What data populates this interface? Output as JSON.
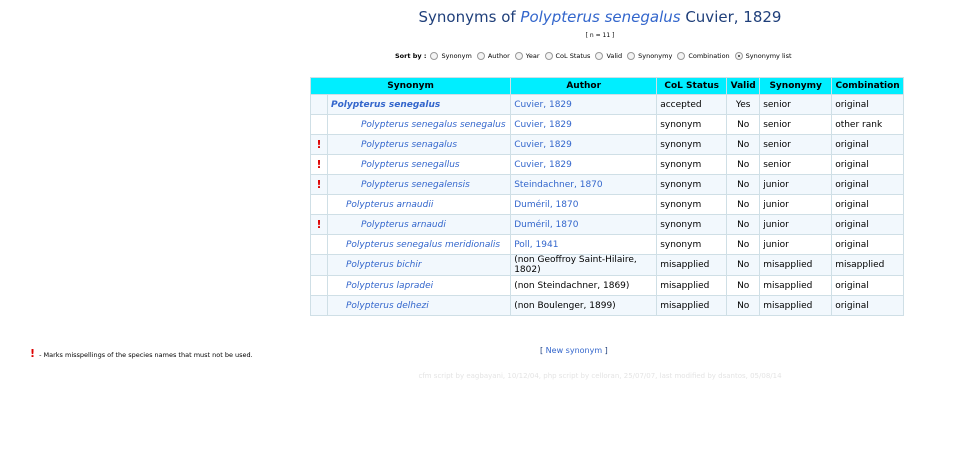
{
  "title": {
    "prefix": "Synonyms of ",
    "species": "Polypterus senegalus",
    "suffix": " Cuvier, 1829"
  },
  "count": "[ n = 11 ]",
  "sort": {
    "label": "Sort by :",
    "options": [
      {
        "label": "Synonym",
        "selected": false
      },
      {
        "label": "Author",
        "selected": false
      },
      {
        "label": "Year",
        "selected": false
      },
      {
        "label": "CoL Status",
        "selected": false
      },
      {
        "label": "Valid",
        "selected": false
      },
      {
        "label": "Synonymy",
        "selected": false
      },
      {
        "label": "Combination",
        "selected": false
      },
      {
        "label": "Synonymy list",
        "selected": true
      }
    ]
  },
  "table": {
    "headers": {
      "synonym": "Synonym",
      "author": "Author",
      "status": "CoL Status",
      "valid": "Valid",
      "synonymy": "Synonymy",
      "combination": "Combination"
    },
    "rows": [
      {
        "mark": "",
        "synonym": "Polypterus senegalus",
        "author": "Cuvier, 1829",
        "status": "accepted",
        "valid": "Yes",
        "synonymy": "senior",
        "combination": "original"
      },
      {
        "mark": "",
        "synonym": "Polypterus senegalus senegalus",
        "author": "Cuvier, 1829",
        "status": "synonym",
        "valid": "No",
        "synonymy": "senior",
        "combination": "other rank"
      },
      {
        "mark": "!",
        "synonym": "Polypterus senagalus",
        "author": "Cuvier, 1829",
        "status": "synonym",
        "valid": "No",
        "synonymy": "senior",
        "combination": "original"
      },
      {
        "mark": "!",
        "synonym": "Polypterus senegallus",
        "author": "Cuvier, 1829",
        "status": "synonym",
        "valid": "No",
        "synonymy": "senior",
        "combination": "original"
      },
      {
        "mark": "!",
        "synonym": "Polypterus senegalensis",
        "author": "Steindachner, 1870",
        "status": "synonym",
        "valid": "No",
        "synonymy": "junior",
        "combination": "original"
      },
      {
        "mark": "",
        "synonym": "Polypterus arnaudii",
        "author": "Duméril, 1870",
        "status": "synonym",
        "valid": "No",
        "synonymy": "junior",
        "combination": "original"
      },
      {
        "mark": "!",
        "synonym": "Polypterus arnaudi",
        "author": "Duméril, 1870",
        "status": "synonym",
        "valid": "No",
        "synonymy": "junior",
        "combination": "original"
      },
      {
        "mark": "",
        "synonym": "Polypterus senegalus meridionalis",
        "author": "Poll, 1941",
        "status": "synonym",
        "valid": "No",
        "synonymy": "junior",
        "combination": "original"
      },
      {
        "mark": "",
        "synonym": "Polypterus bichir",
        "author": "(non Geoffroy Saint-Hilaire, 1802)",
        "status": "misapplied",
        "valid": "No",
        "synonymy": "misapplied",
        "combination": "misapplied"
      },
      {
        "mark": "",
        "synonym": "Polypterus lapradei",
        "author": "(non Steindachner, 1869)",
        "status": "misapplied",
        "valid": "No",
        "synonymy": "misapplied",
        "combination": "original"
      },
      {
        "mark": "",
        "synonym": "Polypterus delhezi",
        "author": "(non Boulenger, 1899)",
        "status": "misapplied",
        "valid": "No",
        "synonymy": "misapplied",
        "combination": "original"
      }
    ]
  },
  "legend": {
    "mark": "!",
    "text": " - Marks misspellings of the species names that must not be used."
  },
  "new_synonym": {
    "open": "[ ",
    "link": "New synonym",
    "close": " ]"
  },
  "footer": "cfm script by eagbayani, 10/12/04, php script by celloran, 25/07/07, last modified by dsantos, 05/08/14",
  "colors": {
    "header_bg": "#00eeff",
    "link": "#3366cc",
    "title": "#1f3f7a",
    "mark": "#dd0000"
  }
}
